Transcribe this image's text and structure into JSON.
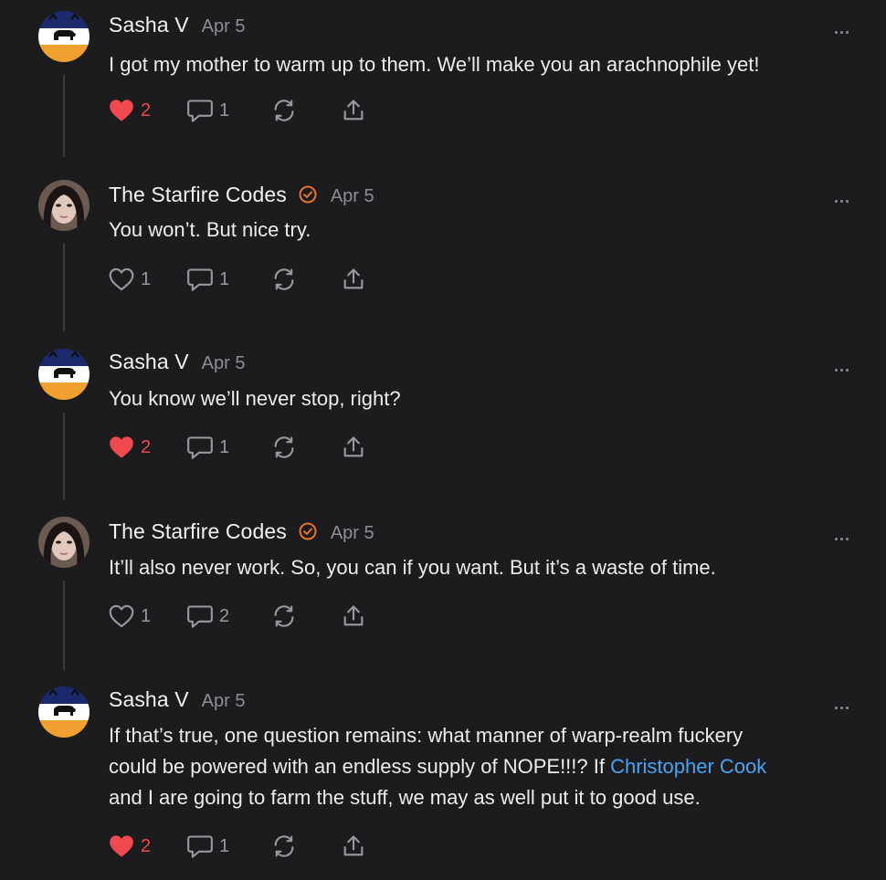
{
  "colors": {
    "like_active": "#f0494f",
    "mention": "#4aa3f0",
    "verified": "#e8742a",
    "background": "#1c1c1e"
  },
  "comments": [
    {
      "author": "Sasha V",
      "date": "Apr 5",
      "verified": false,
      "avatar": "bison-flag-avatar",
      "body": "I got my mother to warm up to them. We’ll make you an arachnophile yet!",
      "likes": "2",
      "liked": true,
      "replies": "1"
    },
    {
      "author": "The Starfire Codes",
      "date": "Apr 5",
      "verified": true,
      "avatar": "profile-photo-avatar",
      "body": "You won’t. But nice try.",
      "likes": "1",
      "liked": false,
      "replies": "1"
    },
    {
      "author": "Sasha V",
      "date": "Apr 5",
      "verified": false,
      "avatar": "bison-flag-avatar",
      "body": "You know we’ll never stop, right?",
      "likes": "2",
      "liked": true,
      "replies": "1"
    },
    {
      "author": "The Starfire Codes",
      "date": "Apr 5",
      "verified": true,
      "avatar": "profile-photo-avatar",
      "body": "It’ll also never work. So, you can if you want. But it’s a waste of time.",
      "likes": "1",
      "liked": false,
      "replies": "2"
    },
    {
      "author": "Sasha V",
      "date": "Apr 5",
      "verified": false,
      "avatar": "bison-flag-avatar",
      "body_line1": "If that’s true, one question remains: what manner of warp-realm fuckery",
      "body_line2_pre": "could be powered with an endless supply of NOPE!!!? If ",
      "mention": "Christopher Cook",
      "body_line3": "and I are going to farm the stuff, we may as well put it to good use.",
      "likes": "2",
      "liked": true,
      "replies": "1"
    }
  ]
}
